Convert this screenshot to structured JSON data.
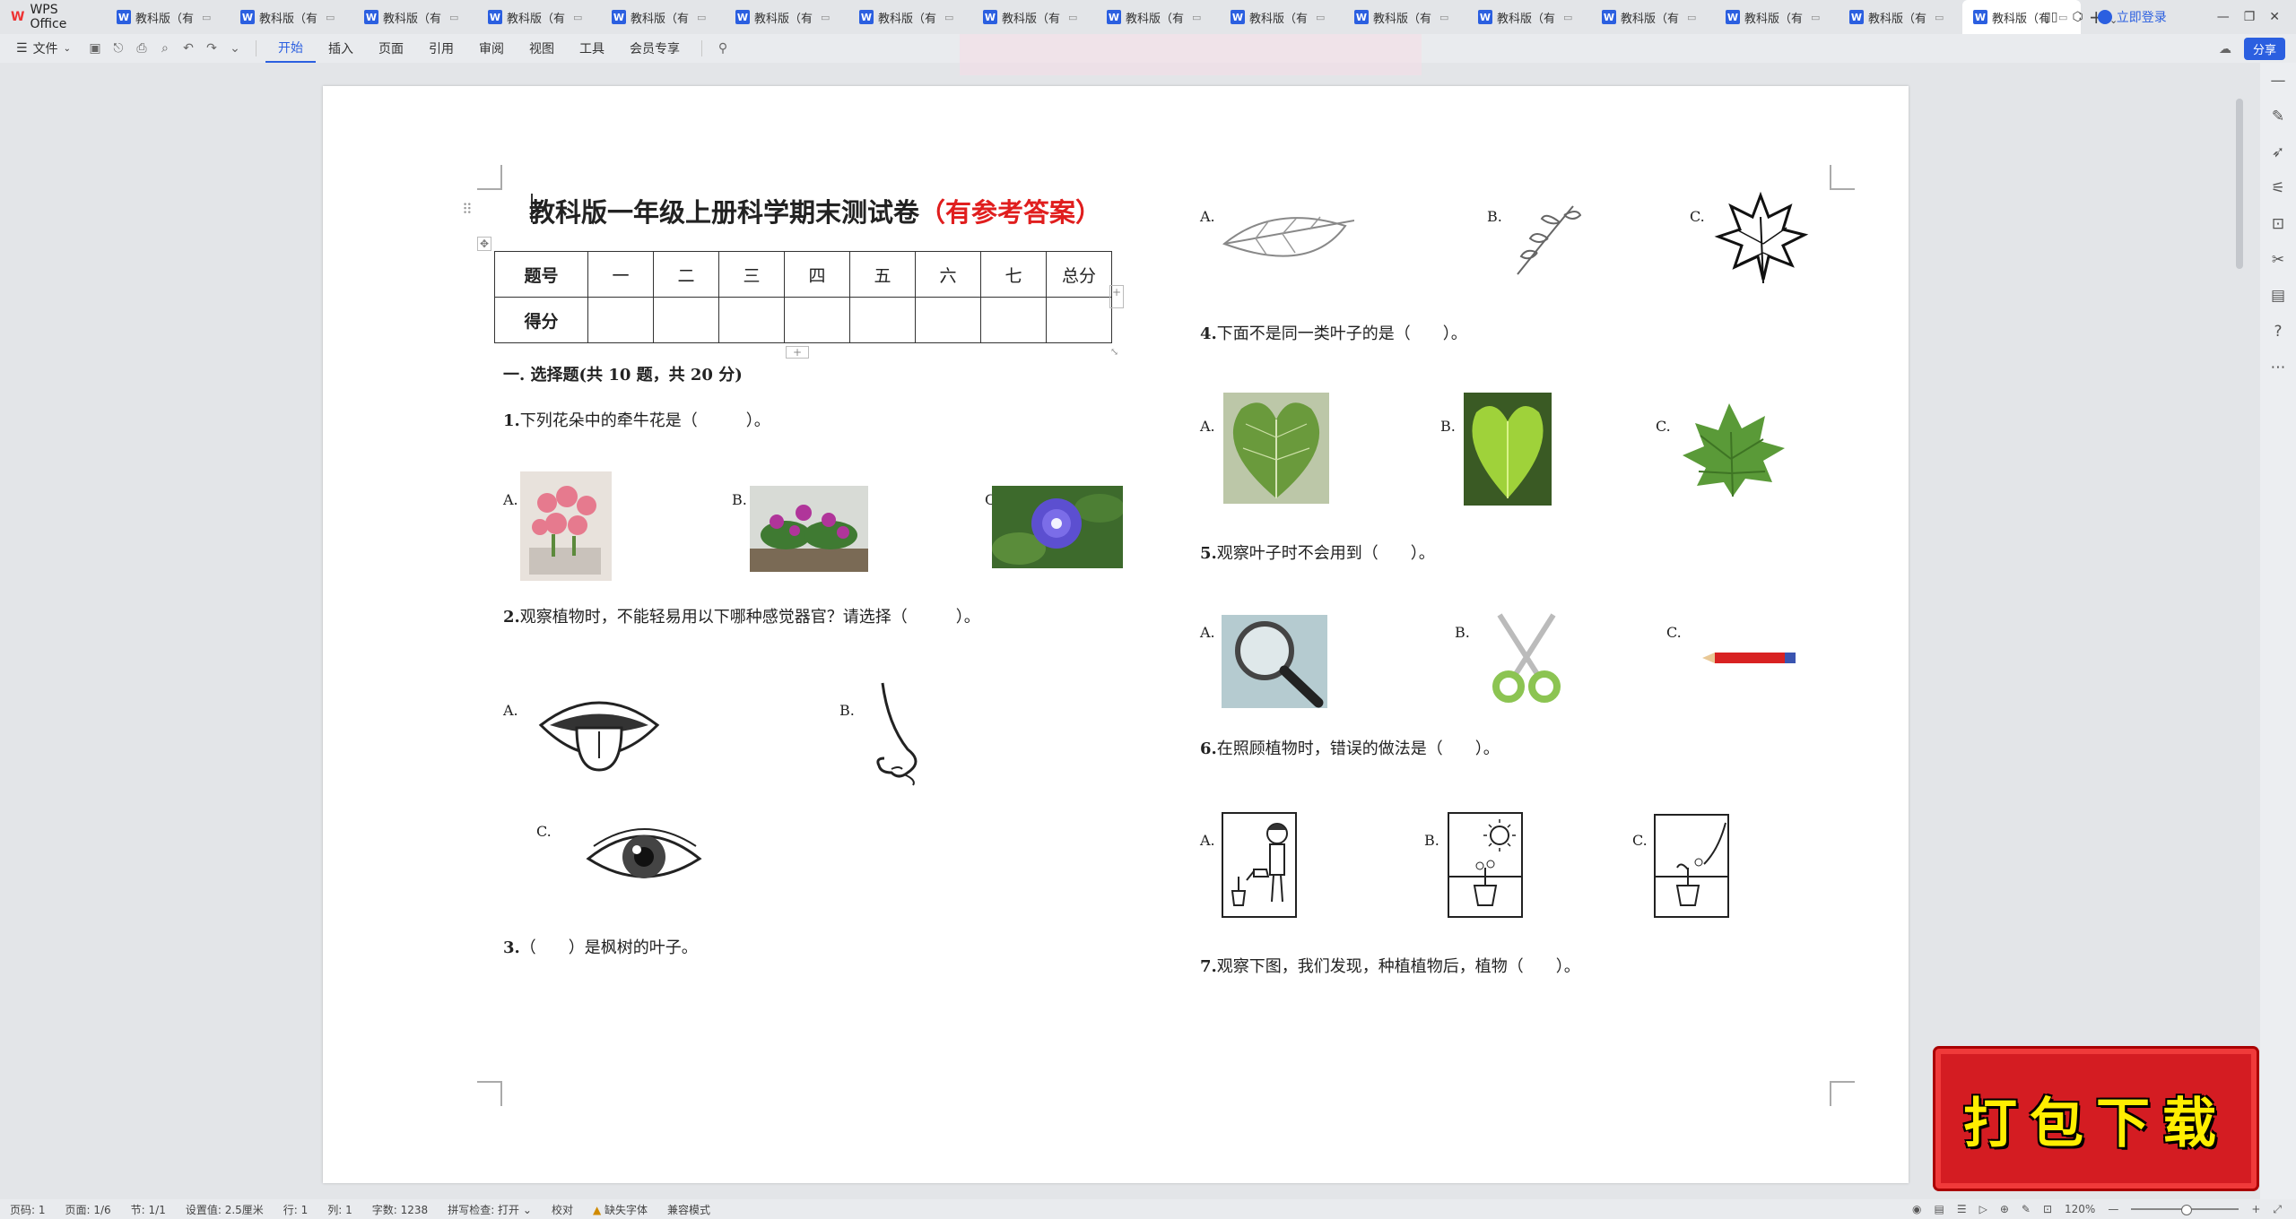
{
  "app": {
    "name": "WPS Office"
  },
  "tabs": [
    {
      "label": "教科版（有"
    },
    {
      "label": "教科版（有"
    },
    {
      "label": "教科版（有"
    },
    {
      "label": "教科版（有"
    },
    {
      "label": "教科版（有"
    },
    {
      "label": "教科版（有"
    },
    {
      "label": "教科版（有"
    },
    {
      "label": "教科版（有"
    },
    {
      "label": "教科版（有"
    },
    {
      "label": "教科版（有"
    },
    {
      "label": "教科版（有"
    },
    {
      "label": "教科版（有"
    },
    {
      "label": "教科版（有"
    },
    {
      "label": "教科版（有"
    },
    {
      "label": "教科版（有"
    },
    {
      "label": "教科版（有"
    }
  ],
  "tab_icon": "W",
  "header_right": {
    "login": "立即登录"
  },
  "toolbar": {
    "file": "文件",
    "ribbon_tabs": [
      "开始",
      "插入",
      "页面",
      "引用",
      "审阅",
      "视图",
      "工具",
      "会员专享"
    ],
    "share": "分享"
  },
  "doc": {
    "title_main": "教科版一年级上册科学期末测试卷",
    "title_red": "（有参考答案）",
    "table": {
      "row1": [
        "题号",
        "一",
        "二",
        "三",
        "四",
        "五",
        "六",
        "七",
        "总分"
      ],
      "row2": [
        "得分",
        "",
        "",
        "",
        "",
        "",
        "",
        "",
        ""
      ]
    },
    "section1": "一. 选择题(共 10 题，共 20 分)",
    "q1": {
      "num": "1.",
      "text": "下列花朵中的牵牛花是（　　　）。"
    },
    "q2": {
      "num": "2.",
      "text": "观察植物时，不能轻易用以下哪种感觉器官？请选择（　　　）。"
    },
    "q3": {
      "num": "3.",
      "text": "（　　）是枫树的叶子。"
    },
    "q4": {
      "num": "4.",
      "text": "下面不是同一类叶子的是（　　）。"
    },
    "q5": {
      "num": "5.",
      "text": "观察叶子时不会用到（　　）。"
    },
    "q6": {
      "num": "6.",
      "text": "在照顾植物时，错误的做法是（　　）。"
    },
    "q7": {
      "num": "7.",
      "text": "观察下图，我们发现，种植植物后，植物（　　）。"
    },
    "opts": {
      "a": "A.",
      "b": "B.",
      "c": "C."
    }
  },
  "statusbar": {
    "page": "页码: 1",
    "pages": "页面: 1/6",
    "section": "节: 1/1",
    "setting": "设置值: 2.5厘米",
    "row": "行: 1",
    "col": "列: 1",
    "words": "字数: 1238",
    "spell": "拼写检查: 打开",
    "proof": "校对",
    "font_missing": "缺失字体",
    "compat": "兼容模式",
    "zoom": "120%"
  },
  "banner": {
    "text": "打包下载"
  },
  "colors": {
    "accent": "#2b5fe0",
    "title_red": "#e01e1e",
    "banner_red": "#d41c22",
    "banner_text": "#ffee00"
  }
}
